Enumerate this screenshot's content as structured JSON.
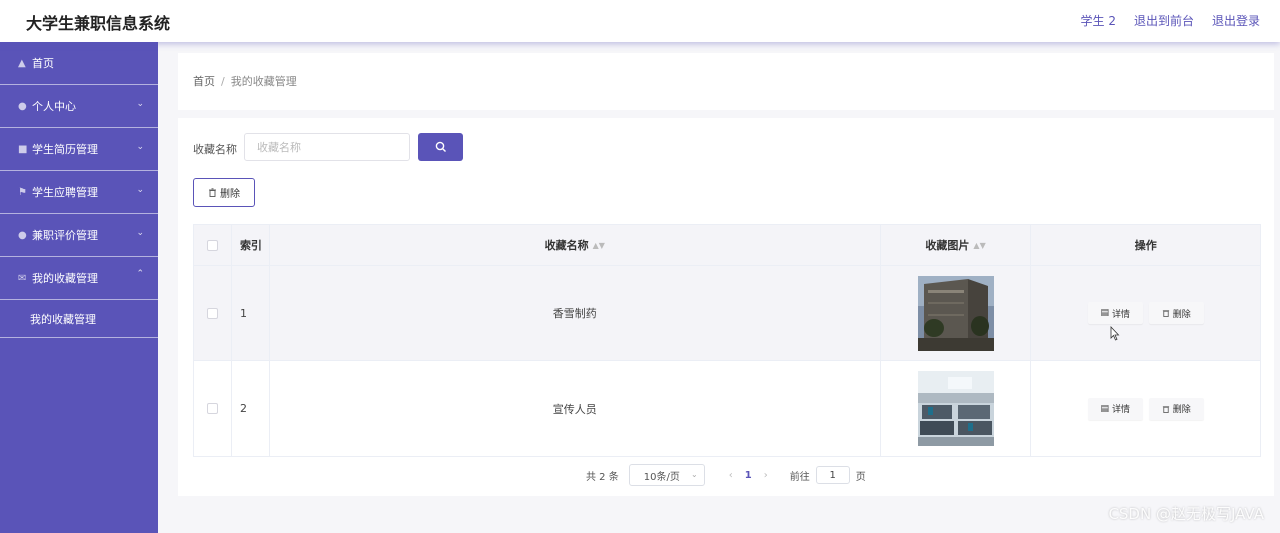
{
  "header": {
    "title": "大学生兼职信息系统",
    "links": [
      "学生 2",
      "退出到前台",
      "退出登录"
    ]
  },
  "sidebar": {
    "items": [
      {
        "label": "首页",
        "icon": "home-icon"
      },
      {
        "label": "个人中心",
        "icon": "user-icon"
      },
      {
        "label": "学生简历管理",
        "icon": "resume-icon"
      },
      {
        "label": "学生应聘管理",
        "icon": "flag-icon"
      },
      {
        "label": "兼职评价管理",
        "icon": "user-icon"
      },
      {
        "label": "我的收藏管理",
        "icon": "mail-icon"
      }
    ],
    "subitem": "我的收藏管理"
  },
  "breadcrumb": {
    "home": "首页",
    "current": "我的收藏管理"
  },
  "search": {
    "label": "收藏名称",
    "placeholder": "收藏名称"
  },
  "toolbar": {
    "delete_label": "删除"
  },
  "table": {
    "headers": {
      "index": "索引",
      "name": "收藏名称",
      "image": "收藏图片",
      "ops": "操作"
    },
    "rows": [
      {
        "index": "1",
        "name": "香雪制药",
        "detail": "详情",
        "delete": "删除"
      },
      {
        "index": "2",
        "name": "宣传人员",
        "detail": "详情",
        "delete": "删除"
      }
    ]
  },
  "pagination": {
    "total": "共 2 条",
    "page_size": "10条/页",
    "current": "1",
    "goto_label": "前往",
    "goto_value": "1",
    "page_suffix": "页"
  },
  "watermark": "CSDN @赵无极写JAVA",
  "colors": {
    "accent": "#5a54b8",
    "background": "#f6f6f9"
  }
}
